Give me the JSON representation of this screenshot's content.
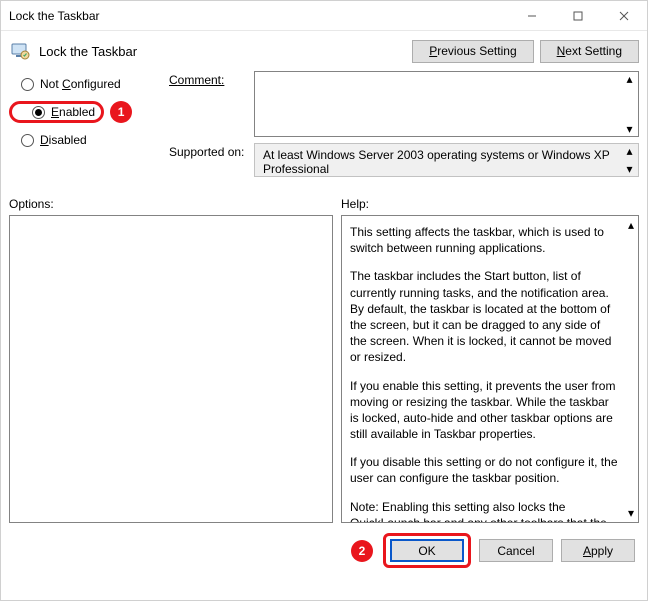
{
  "window": {
    "title": "Lock the Taskbar",
    "header_title": "Lock the Taskbar"
  },
  "nav_buttons": {
    "previous": "Previous Setting",
    "next": "Next Setting"
  },
  "radios": {
    "not_configured": "Not Configured",
    "enabled": "Enabled",
    "disabled": "Disabled",
    "selected": "enabled"
  },
  "fields": {
    "comment_label": "Comment:",
    "comment_value": "",
    "supported_label": "Supported on:",
    "supported_value": "At least Windows Server 2003 operating systems or Windows XP Professional"
  },
  "panes": {
    "options_label": "Options:",
    "help_label": "Help:",
    "help_paragraphs": [
      "This setting affects the taskbar, which is used to switch between running applications.",
      "The taskbar includes the Start button, list of currently running tasks, and the notification area. By default, the taskbar is located at the bottom of the screen, but it can be dragged to any side of the screen. When it is locked, it cannot be moved or resized.",
      "If you enable this setting, it prevents the user from moving or resizing the taskbar. While the taskbar is locked, auto-hide and other taskbar options are still available in Taskbar properties.",
      "If you disable this setting or do not configure it, the user can configure the taskbar position.",
      "Note: Enabling this setting also locks the QuickLaunch bar and any other toolbars that the user has on their taskbar. The toolbar's position is locked, and the user cannot show and hide various toolbars using the taskbar context menu."
    ]
  },
  "footer": {
    "ok": "OK",
    "cancel": "Cancel",
    "apply": "Apply"
  },
  "annotations": {
    "c1": "1",
    "c2": "2"
  }
}
